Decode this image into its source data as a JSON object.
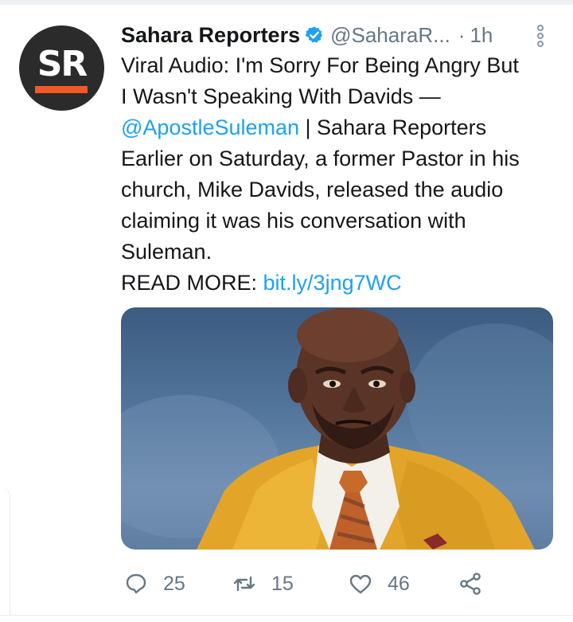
{
  "tweet": {
    "author": {
      "name": "Sahara Reporters",
      "handle": "@SaharaR...",
      "avatar_text": "SR",
      "verified": true,
      "verified_icon": "verified-badge-icon"
    },
    "dot": "·",
    "time": "1h",
    "body": {
      "line1": "Viral Audio: I'm Sorry For Being Angry But",
      "line2": "I Wasn't Speaking With Davids —",
      "mention": "@ApostleSuleman",
      "line3_rest": " | Sahara Reporters",
      "line4": "Earlier on Saturday, a former Pastor in his",
      "line5": "church, Mike Davids, released the audio",
      "line6": "claiming it was his conversation with",
      "line7": "Suleman.",
      "read_more": "READ MORE: ",
      "url": "bit.ly/3jng7WC"
    },
    "actions": {
      "replies": "25",
      "retweets": "15",
      "likes": "46"
    }
  },
  "colors": {
    "link": "#1da1f2",
    "muted": "#657786",
    "text": "#14171a",
    "avatar_bg": "#2b2b2b",
    "avatar_accent": "#f15a24",
    "verified": "#1da1f2"
  },
  "icons": [
    "more-options-icon",
    "reply-icon",
    "retweet-icon",
    "like-icon",
    "share-icon"
  ]
}
